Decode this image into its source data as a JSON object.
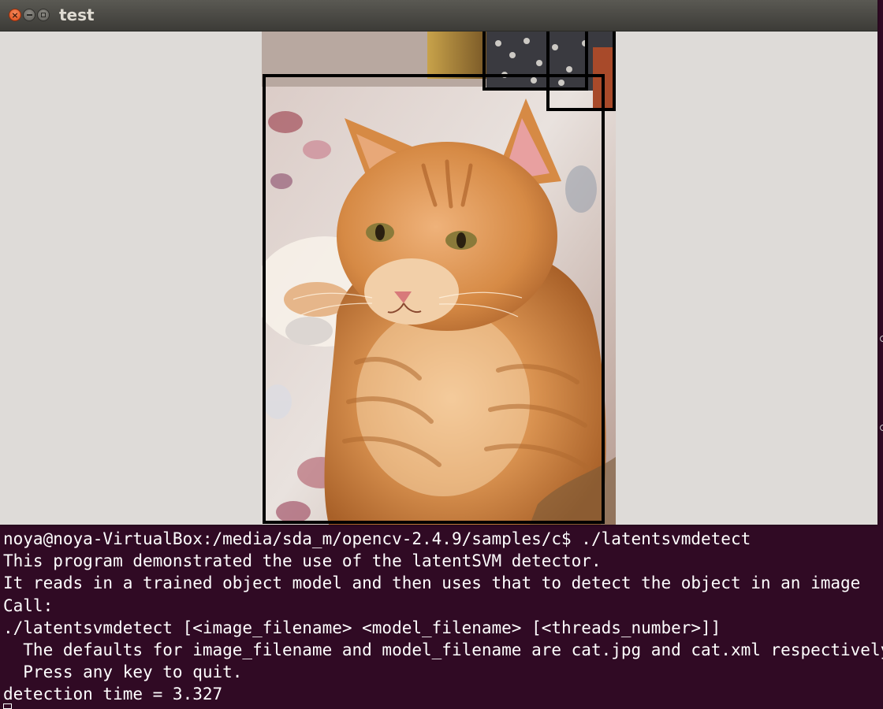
{
  "window": {
    "title": "test",
    "controls": {
      "close_glyph": "×",
      "minimize_glyph": "",
      "maximize_glyph": ""
    }
  },
  "terminal": {
    "lines": [
      "noya@noya-VirtualBox:/media/sda_m/opencv-2.4.9/samples/c$ ./latentsvmdetect",
      "This program demonstrated the use of the latentSVM detector.",
      "It reads in a trained object model and then uses that to detect the object in an image",
      "Call:",
      "./latentsvmdetect [<image_filename> <model_filename> [<threads_number>]]",
      "  The defaults for image_filename and model_filename are cat.jpg and cat.xml respectively",
      "  Press any key to quit.",
      "detection time = 3.327"
    ]
  },
  "colors": {
    "terminal_bg": "#300a24",
    "terminal_fg": "#ffffff",
    "window_bg": "#dedbd8",
    "titlebar": "#3c3b37",
    "close_button": "#df4b16",
    "detection_box": "#000000"
  },
  "image": {
    "subject": "orange-tabby-cat-photo",
    "detections_count": 3
  }
}
